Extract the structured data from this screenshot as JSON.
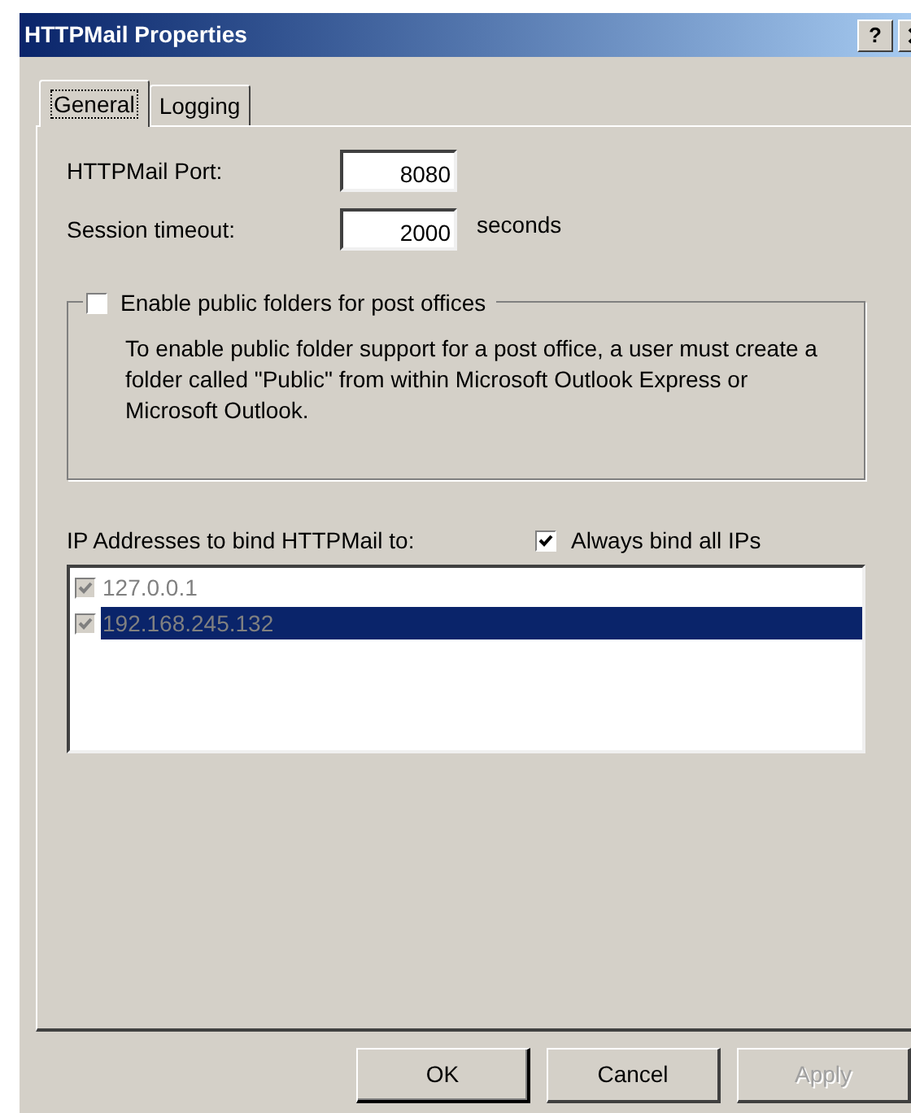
{
  "window": {
    "title": "HTTPMail Properties",
    "help_button": "?"
  },
  "tabs": [
    {
      "label": "General",
      "selected": true
    },
    {
      "label": "Logging",
      "selected": false
    }
  ],
  "fields": [
    {
      "label": "HTTPMail Port:",
      "value": "8080"
    },
    {
      "label": "Session timeout:",
      "value": "2000",
      "unit": "seconds"
    }
  ],
  "public_folders": {
    "label": "Enable public folders for post offices",
    "checked": false,
    "description": "To enable public folder support for a post office, a user must create a folder called \"Public\" from within Microsoft Outlook Express or Microsoft Outlook."
  },
  "ip_binding": {
    "label": "IP Addresses to bind HTTPMail to:",
    "always_bind": {
      "label": "Always bind all IPs",
      "checked": true
    },
    "addresses": [
      {
        "address": "127.0.0.1",
        "checked": true,
        "selected": false
      },
      {
        "address": "192.168.245.132",
        "checked": true,
        "selected": true
      }
    ]
  },
  "buttons": [
    {
      "label": "OK",
      "default": true,
      "disabled": false
    },
    {
      "label": "Cancel",
      "default": false,
      "disabled": false
    },
    {
      "label": "Apply",
      "default": false,
      "disabled": true
    }
  ]
}
